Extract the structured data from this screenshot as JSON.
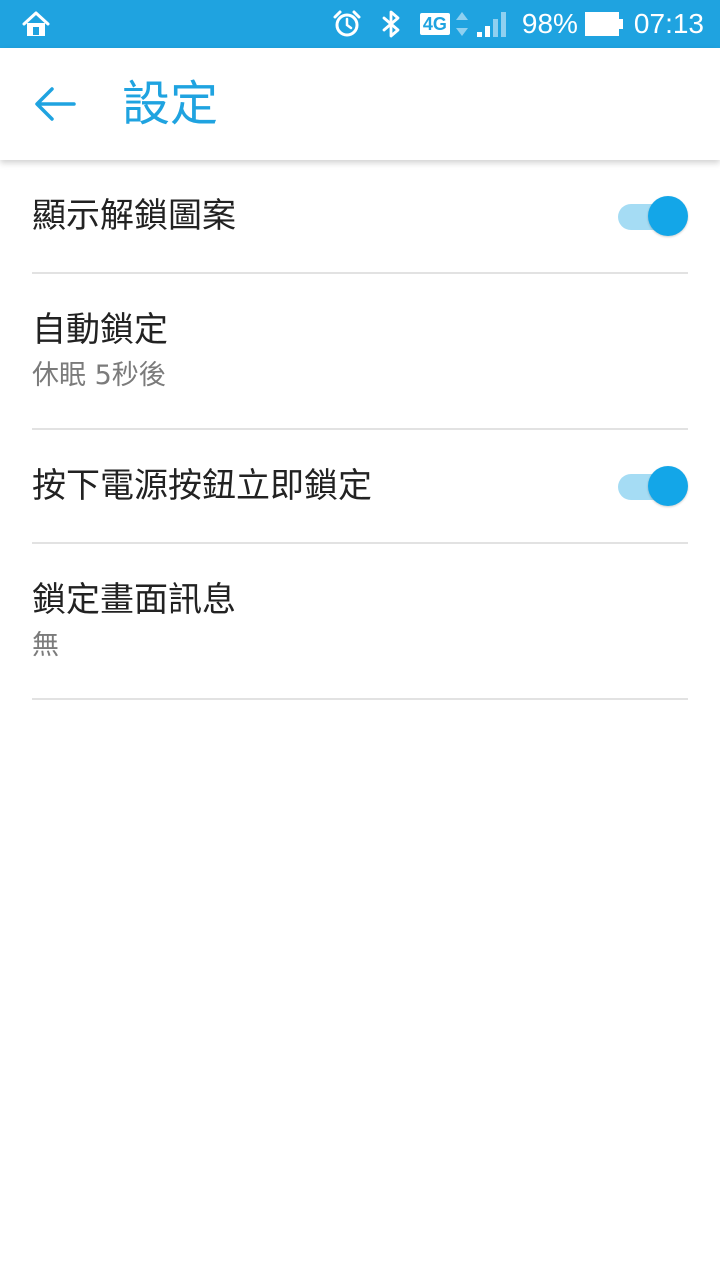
{
  "status_bar": {
    "network": "4G",
    "battery_percent": "98%",
    "time": "07:13",
    "icons": [
      "home-icon",
      "alarm-icon",
      "bluetooth-icon",
      "data-arrows-icon",
      "signal-icon",
      "battery-icon"
    ]
  },
  "app_bar": {
    "title": "設定",
    "back_icon": "back-arrow-icon"
  },
  "settings": [
    {
      "title": "顯示解鎖圖案",
      "toggle_on": true
    },
    {
      "title": "自動鎖定",
      "subtitle": "休眠 5秒後"
    },
    {
      "title": "按下電源按鈕立即鎖定",
      "toggle_on": true
    },
    {
      "title": "鎖定畫面訊息",
      "subtitle": "無"
    }
  ],
  "colors": {
    "accent": "#1fa3e0",
    "toggle_track": "#a5dcf4",
    "toggle_thumb": "#13a6e8",
    "divider": "#e2e2e2"
  }
}
